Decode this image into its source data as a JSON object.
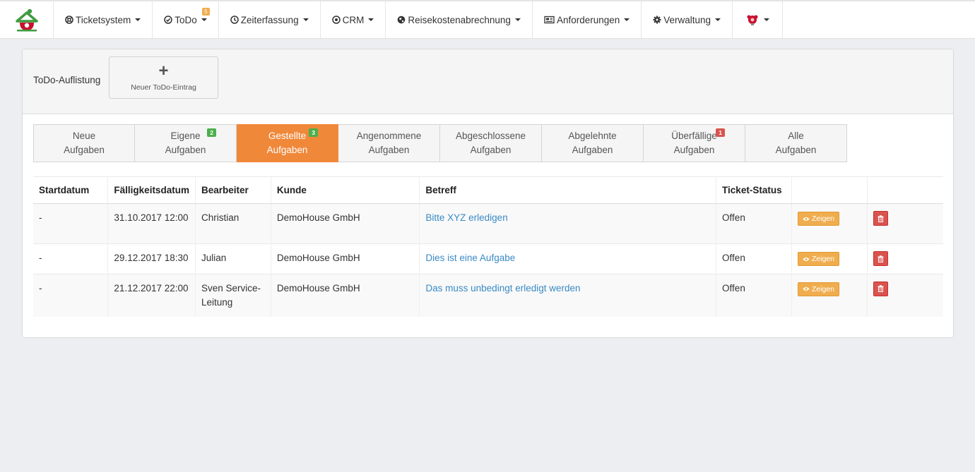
{
  "nav": {
    "items": [
      {
        "label": "Ticketsystem",
        "icon": "lifebuoy-icon"
      },
      {
        "label": "ToDo",
        "icon": "check-circle-icon",
        "badge": "5"
      },
      {
        "label": "Zeiterfassung",
        "icon": "clock-icon"
      },
      {
        "label": "CRM",
        "icon": "target-icon"
      },
      {
        "label": "Reisekostenabrechnung",
        "icon": "globe-icon"
      },
      {
        "label": "Anforderungen",
        "icon": "newspaper-icon"
      },
      {
        "label": "Verwaltung",
        "icon": "gear-icon"
      }
    ],
    "accent": "#f0ad4e"
  },
  "panel": {
    "title": "ToDo-Auflistung",
    "new_button_label": "Neuer ToDo-Eintrag"
  },
  "tabs": [
    {
      "line1": "Neue",
      "line2": "Aufgaben",
      "badge": ""
    },
    {
      "line1": "Eigene",
      "line2": "Aufgaben",
      "badge": "2"
    },
    {
      "line1": "Gestellte",
      "line2": "Aufgaben",
      "badge": "3",
      "active": true
    },
    {
      "line1": "Angenommene",
      "line2": "Aufgaben",
      "badge": ""
    },
    {
      "line1": "Abgeschlossene",
      "line2": "Aufgaben",
      "badge": ""
    },
    {
      "line1": "Abgelehnte",
      "line2": "Aufgaben",
      "badge": ""
    },
    {
      "line1": "Überfällige",
      "line2": "Aufgaben",
      "badge": "1"
    },
    {
      "line1": "Alle",
      "line2": "Aufgaben",
      "badge": ""
    }
  ],
  "table": {
    "headers": [
      "Startdatum",
      "Fälligkeitsdatum",
      "Bearbeiter",
      "Kunde",
      "Betreff",
      "Ticket-Status",
      "",
      ""
    ],
    "show_label": "Zeigen",
    "rows": [
      {
        "start": "-",
        "due": "31.10.2017 12:00",
        "assignee": "Christian",
        "customer": "DemoHouse GmbH",
        "subject": "Bitte XYZ erledigen",
        "status": "Offen"
      },
      {
        "start": "-",
        "due": "29.12.2017 18:30",
        "assignee": "Julian",
        "customer": "DemoHouse GmbH",
        "subject": "Dies ist eine Aufgabe",
        "status": "Offen"
      },
      {
        "start": "-",
        "due": "21.12.2017 22:00",
        "assignee": "Sven Service-Leitung",
        "customer": "DemoHouse GmbH",
        "subject": "Das muss unbedingt erledigt werden",
        "status": "Offen"
      }
    ]
  },
  "colors": {
    "active_tab": "#f0883a",
    "badge_green": "#4cae4c",
    "badge_red": "#d9534f",
    "link": "#3a8ac4"
  }
}
